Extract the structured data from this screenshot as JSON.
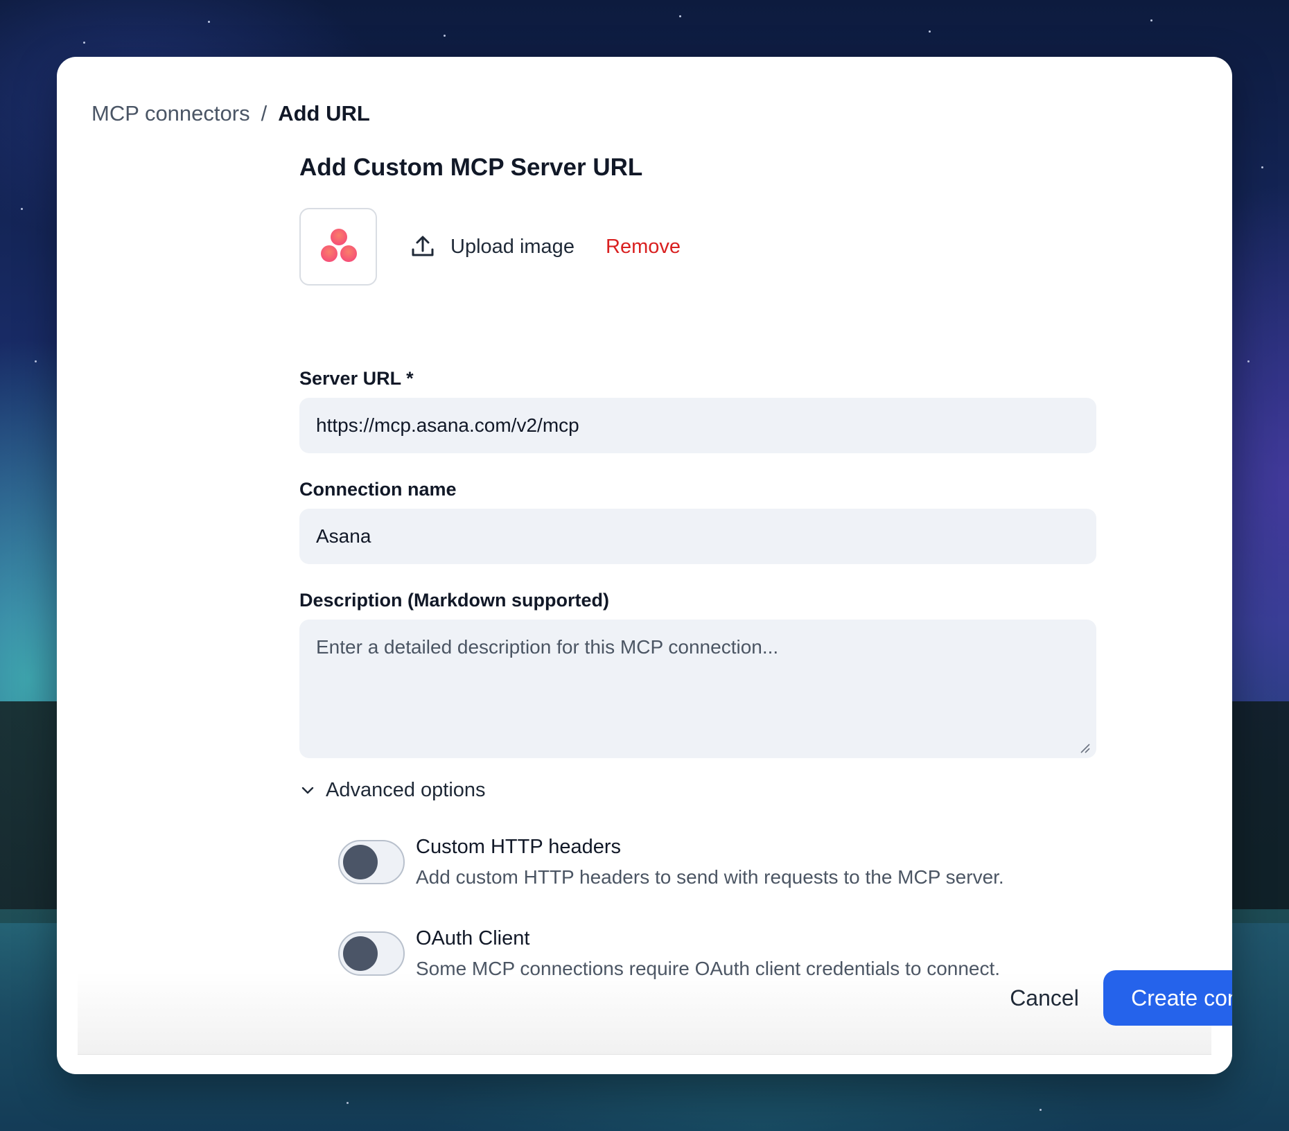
{
  "breadcrumb": {
    "parent": "MCP connectors",
    "separator": "/",
    "current": "Add URL"
  },
  "form": {
    "title": "Add Custom MCP Server URL",
    "upload_label": "Upload image",
    "remove_label": "Remove",
    "server_url": {
      "label": "Server URL *",
      "value": "https://mcp.asana.com/v2/mcp"
    },
    "connection_name": {
      "label": "Connection name",
      "value": "Asana"
    },
    "description": {
      "label": "Description (Markdown supported)",
      "placeholder": "Enter a detailed description for this MCP connection..."
    },
    "advanced": {
      "label": "Advanced options",
      "options": [
        {
          "title": "Custom HTTP headers",
          "description": "Add custom HTTP headers to send with requests to the MCP server.",
          "enabled": false
        },
        {
          "title": "OAuth Client",
          "description": "Some MCP connections require OAuth client credentials to connect.",
          "enabled": false
        }
      ]
    }
  },
  "actions": {
    "cancel_label": "Cancel",
    "create_label": "Create connection"
  },
  "colors": {
    "primary": "#2563eb",
    "danger": "#d92020",
    "logo_gradient": [
      "#f97f6a",
      "#f5457a"
    ]
  },
  "icons": {
    "logo": "asana-logo-icon",
    "upload": "upload-icon",
    "chevron": "chevron-down-icon"
  }
}
